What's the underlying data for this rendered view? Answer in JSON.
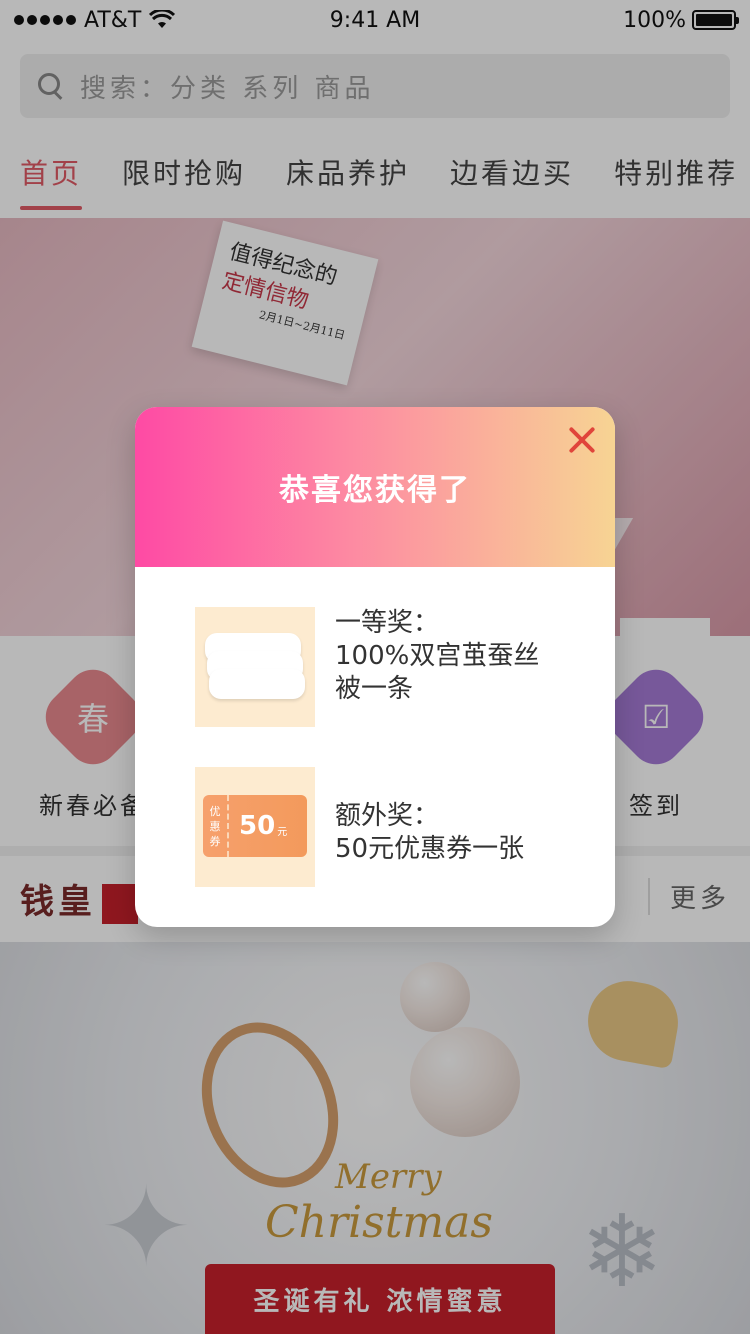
{
  "status_bar": {
    "carrier": "AT&T",
    "time": "9:41 AM",
    "battery": "100%"
  },
  "search": {
    "placeholder": "搜索：分类 系列 商品"
  },
  "tabs": [
    {
      "label": "首页",
      "active": true
    },
    {
      "label": "限时抢购",
      "active": false
    },
    {
      "label": "床品养护",
      "active": false
    },
    {
      "label": "边看边买",
      "active": false
    },
    {
      "label": "特别推荐",
      "active": false
    }
  ],
  "hero_banner": {
    "card_lines": [
      "值得纪念的",
      "定情信物",
      "2月1日~2月11日"
    ]
  },
  "quick_links": [
    {
      "label": "新春必备",
      "glyph": "春",
      "color": "#e98a8f",
      "icon": "spring-icon"
    },
    {
      "label": "签到",
      "glyph": "☑",
      "color": "#a67bd6",
      "icon": "calendar-check-icon"
    }
  ],
  "brand_strip": {
    "logo": "钱皇",
    "more_label": "更多"
  },
  "xmas_banner": {
    "script_1": "Merry",
    "script_2": "Christmas",
    "ribbon": "圣诞有礼 浓情蜜意"
  },
  "modal": {
    "title": "恭喜您获得了",
    "prizes": [
      {
        "line1": "一等奖：",
        "line2": "100%双宫茧蚕丝",
        "line3": "被一条",
        "image": "silk-quilt-icon"
      },
      {
        "line1": "额外奖：",
        "line2": "50元优惠券一张",
        "image": "coupon-icon",
        "coupon": {
          "side": "优惠券",
          "value": "50",
          "unit": "元"
        }
      }
    ],
    "colors": {
      "gradient_start": "#fe4aa4",
      "gradient_end": "#f7d493",
      "close": "#e0453b"
    }
  }
}
